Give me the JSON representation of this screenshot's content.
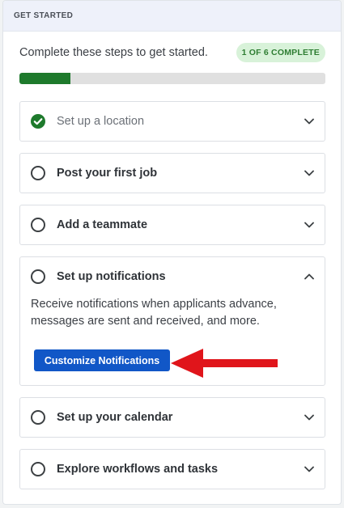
{
  "header": {
    "title": "GET STARTED"
  },
  "intro": {
    "text": "Complete these steps to get started.",
    "badge": "1 OF 6 COMPLETE"
  },
  "progress": {
    "completed": 1,
    "total": 6
  },
  "steps": [
    {
      "title": "Set up a location",
      "done": true,
      "expanded": false
    },
    {
      "title": "Post your first job",
      "done": false,
      "expanded": false
    },
    {
      "title": "Add a teammate",
      "done": false,
      "expanded": false
    },
    {
      "title": "Set up notifications",
      "done": false,
      "expanded": true,
      "description": "Receive notifications when applicants advance, messages are sent and received, and more.",
      "button_label": "Customize Notifications"
    },
    {
      "title": "Set up your calendar",
      "done": false,
      "expanded": false
    },
    {
      "title": "Explore workflows and tasks",
      "done": false,
      "expanded": false
    }
  ],
  "colors": {
    "progress_fill": "#1e7a2c",
    "check": "#1e7a2c",
    "cta": "#1157c7",
    "annotation_arrow": "#e0151b"
  }
}
